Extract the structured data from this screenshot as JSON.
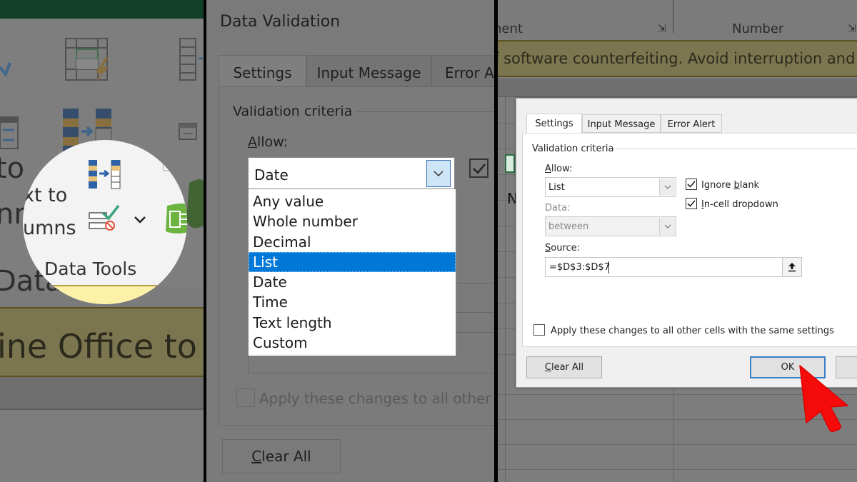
{
  "panel_ribbon": {
    "group_label": "Data Tools",
    "partial_labels": {
      "text_to_big": "to",
      "columns_big": "nn",
      "data_big": "Data",
      "text_to_small": "xt to",
      "columns_small": "umns"
    },
    "banner_text": "ine Office to",
    "icons": [
      "flash-fill-icon",
      "text-to-columns-icon",
      "data-validation-icon",
      "data-validation-dropdown-icon",
      "data-model-icon"
    ]
  },
  "panel_dropdown": {
    "dialog_title": "Data Validation",
    "tabs": [
      {
        "label": "Settings",
        "active": true
      },
      {
        "label": "Input Message",
        "active": false
      },
      {
        "label": "Error Al",
        "active": false
      }
    ],
    "group_label": "Validation criteria",
    "allow_label": "Allow:",
    "allow_accesskey": "A",
    "allow_value": "Date",
    "options": [
      "Any value",
      "Whole number",
      "Decimal",
      "List",
      "Date",
      "Time",
      "Text length",
      "Custom"
    ],
    "selected_option": "List",
    "ignore_blank_checked": true,
    "apply_label": "Apply these changes to all other cel",
    "clear_all_label": "Clear All"
  },
  "panel_dialog": {
    "ribbon_labels": {
      "alignment_partial": "nent",
      "number": "Number",
      "partial_cell": "N"
    },
    "banner_text": "f software counterfeiting. Avoid interruption and keep",
    "tabs": [
      {
        "label": "Settings",
        "active": true
      },
      {
        "label": "Input Message",
        "active": false
      },
      {
        "label": "Error Alert",
        "active": false
      }
    ],
    "group_label": "Validation criteria",
    "allow_label": "Allow:",
    "allow_value": "List",
    "data_label": "Data:",
    "data_value": "between",
    "ignore_blank_label": "Ignore blank",
    "ignore_blank_checked": true,
    "in_cell_dropdown_label": "In-cell dropdown",
    "in_cell_dropdown_checked": true,
    "source_label": "Source:",
    "source_value": "=$D$3:$D$7",
    "apply_label": "Apply these changes to all other cells with the same settings",
    "apply_checked": false,
    "clear_all_label": "Clear All",
    "ok_label": "OK"
  },
  "colors": {
    "selection_blue": "#0078d7",
    "cursor_red": "#ff0000",
    "excel_green": "#123f28",
    "banner_yellow": "#fdf0a7"
  }
}
